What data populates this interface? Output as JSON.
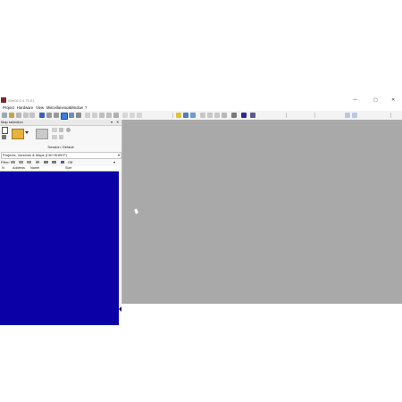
{
  "app": {
    "title": "WinOLS 4.70.01",
    "window_controls": {
      "minimize": "—",
      "maximize": "▢",
      "close": "✕"
    }
  },
  "menu": [
    "Project",
    "Hardware",
    "View",
    "Miscellaneous",
    "Window",
    "?"
  ],
  "map_selection": {
    "title": "Map selection",
    "controls": {
      "pin": "▾",
      "close": "✕"
    },
    "session_label": "Session: Default",
    "dropdown_value": "Projects, Versions & Maps  (Ctrl+Shift+F)",
    "filter_label": "Filter:",
    "filter_value": "Off",
    "columns": [
      "N",
      "Address",
      "Name",
      "Size"
    ]
  },
  "colors": {
    "list_background": "#0a00a6",
    "workspace_background": "#a9a9a9",
    "panel_background": "#f7f7f7"
  }
}
